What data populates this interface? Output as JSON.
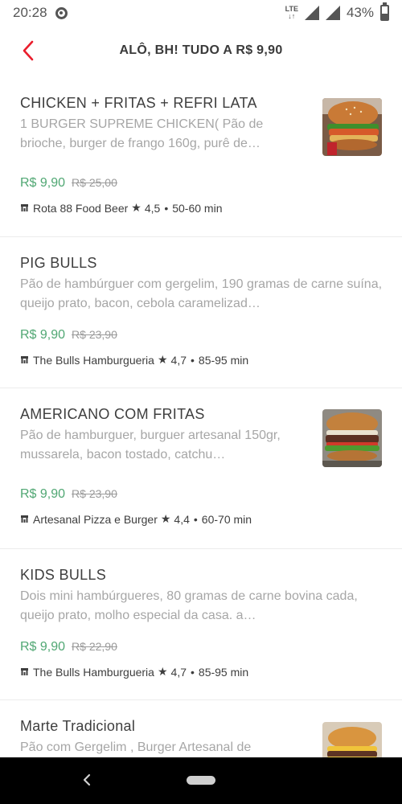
{
  "status_bar": {
    "time": "20:28",
    "network": "LTE",
    "battery": "43%",
    "battery_level": 0.43
  },
  "header": {
    "title": "ALÔ, BH! TUDO A R$ 9,90"
  },
  "items": [
    {
      "title": " CHICKEN + FRITAS + REFRI LATA",
      "description": "1 BURGER SUPREME CHICKEN( Pão de brioche, burger de frango 160g, purê de…",
      "price": "R$  9,90",
      "old_price": "R$  25,00",
      "store": "Rota 88 Food Beer",
      "rating": "4,5",
      "eta": "50-60 min",
      "image": "chicken-burger-photo"
    },
    {
      "title": "PIG BULLS",
      "description": "Pão de hambúrguer com gergelim, 190 gramas de carne suína, queijo prato, bacon, cebola caramelizad…",
      "price": "R$  9,90",
      "old_price": "R$  23,90",
      "store": "The Bulls Hamburgueria",
      "rating": "4,7",
      "eta": "85-95 min",
      "image": null
    },
    {
      "title": "AMERICANO COM FRITAS",
      "description": "Pão de hamburguer, burguer artesanal 150gr, mussarela, bacon tostado, catchu…",
      "price": "R$  9,90",
      "old_price": "R$  23,90",
      "store": "Artesanal Pizza e Burger",
      "rating": "4,4",
      "eta": "60-70 min",
      "image": "beef-burger-photo"
    },
    {
      "title": "KIDS BULLS",
      "description": "Dois mini hambúrgueres, 80 gramas de carne bovina cada, queijo prato, molho especial da casa. a…",
      "price": "R$  9,90",
      "old_price": "R$  22,90",
      "store": "The Bulls Hamburgueria",
      "rating": "4,7",
      "eta": "85-95 min",
      "image": null
    },
    {
      "title": "Marte Tradicional",
      "description": "Pão com Gergelim , Burger Artesanal de",
      "price": "",
      "old_price": "",
      "store": "",
      "rating": "",
      "eta": "",
      "image": "cheese-burger-photo"
    }
  ],
  "colors": {
    "accent": "#ea1d2c",
    "price": "#50a773",
    "muted": "#a6a6a6"
  },
  "icons": {
    "back": "chevron-left-icon",
    "store": "store-icon",
    "rating": "star-icon"
  }
}
